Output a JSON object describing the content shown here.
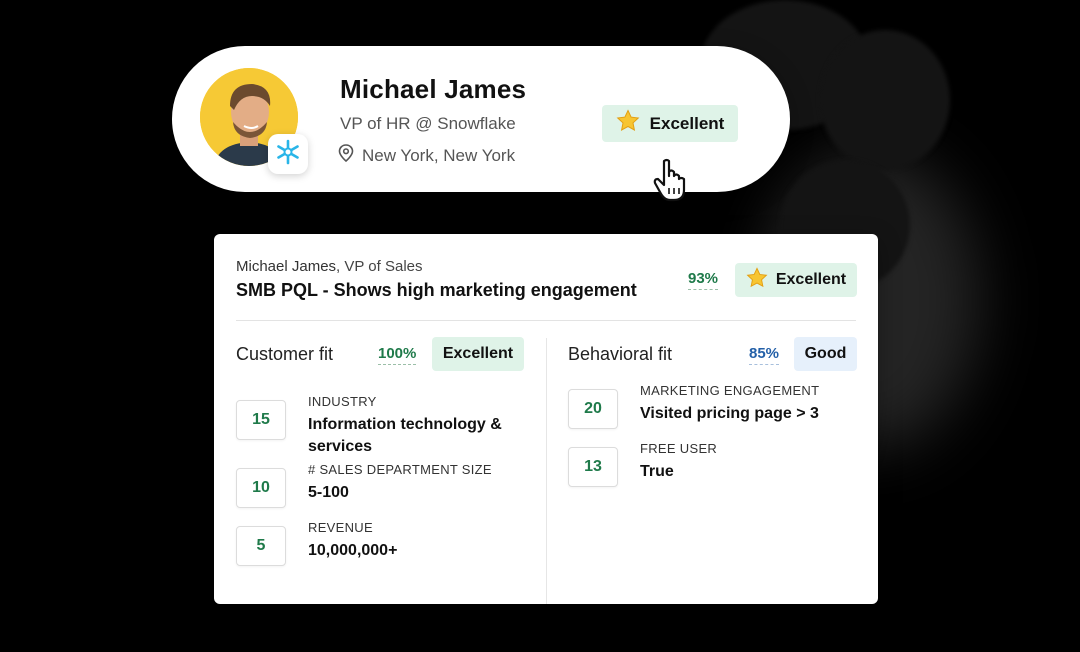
{
  "profile": {
    "name": "Michael James",
    "title": "VP of HR @ Snowflake",
    "location": "New York, New York",
    "rating": "Excellent",
    "icons": {
      "company": "snowflake-icon",
      "location": "location-pin-icon",
      "rating": "star-icon",
      "cursor": "hand-pointer-icon"
    }
  },
  "card": {
    "person_name": "Michael James",
    "person_role": ", VP of Sales",
    "title": "SMB PQL - Shows high marketing engagement",
    "overall_percent": "93%",
    "overall_rating": "Excellent",
    "customer_fit": {
      "title": "Customer fit",
      "percent": "100%",
      "rating": "Excellent",
      "criteria": [
        {
          "score": "15",
          "label": "INDUSTRY",
          "value": "Information technology & services"
        },
        {
          "score": "10",
          "label": "# SALES DEPARTMENT SIZE",
          "value": "5-100"
        },
        {
          "score": "5",
          "label": "REVENUE",
          "value": "10,000,000+"
        }
      ]
    },
    "behavioral_fit": {
      "title": "Behavioral fit",
      "percent": "85%",
      "rating": "Good",
      "criteria": [
        {
          "score": "20",
          "label": "MARKETING ENGAGEMENT",
          "value": "Visited pricing page > 3"
        },
        {
          "score": "13",
          "label": "FREE USER",
          "value": "True"
        }
      ]
    }
  },
  "colors": {
    "excellent_bg": "#dff3e8",
    "good_bg": "#e6f0fb",
    "green_text": "#1f7a4a",
    "blue_text": "#2460a8",
    "avatar_bg": "#f6c935",
    "snowflake": "#29b5e8"
  }
}
